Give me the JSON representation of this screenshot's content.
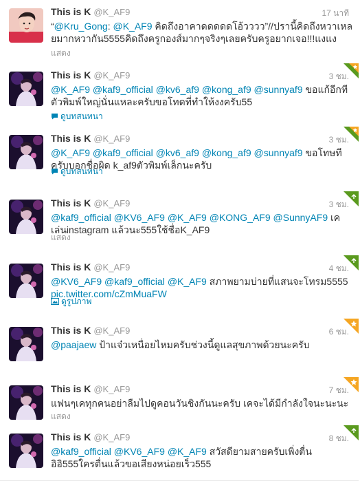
{
  "tweets": [
    {
      "name": "This is K",
      "handle": "@K_AF9",
      "time": "17 นาที",
      "avatar": "selfie-avatar",
      "segments": [
        {
          "t": "“",
          "m": false
        },
        {
          "t": "@Kru_Gong",
          "m": true
        },
        {
          "t": ": ",
          "m": false
        },
        {
          "t": "@K_AF9",
          "m": true
        },
        {
          "t": " คิดถึงอาคาดดดดดโอ้วววว”//ปรานี้คิดถึงหวาเหลยมากหวากัน5555คิดถึงครูกองส์มากๆจริงๆเลยครับครูอยากเจอ!!!แงแง",
          "m": false
        }
      ],
      "action": "แสดง",
      "action_type": "expand",
      "corner": "none"
    },
    {
      "name": "This is K",
      "handle": "@K_AF9",
      "time": "3 ชม.",
      "avatar": "concert-avatar",
      "segments": [
        {
          "t": "@K_AF9",
          "m": true
        },
        {
          "t": " ",
          "m": false
        },
        {
          "t": "@kaf9_official",
          "m": true
        },
        {
          "t": " ",
          "m": false
        },
        {
          "t": "@kv6_af9",
          "m": true
        },
        {
          "t": " ",
          "m": false
        },
        {
          "t": "@kong_af9",
          "m": true
        },
        {
          "t": " ",
          "m": false
        },
        {
          "t": "@sunnyaf9",
          "m": true
        },
        {
          "t": " ขอแก้อีกทีตัวพิมพ์ใหญ่นั่นแหละครับขอโทดที่ทำให้งงครับ55",
          "m": false
        }
      ],
      "action": "ดูบทสนทนา",
      "action_type": "conversation",
      "corner": "retweet-favorite"
    },
    {
      "name": "This is K",
      "handle": "@K_AF9",
      "time": "3 ชม.",
      "avatar": "concert-avatar",
      "segments": [
        {
          "t": "@K_AF9",
          "m": true
        },
        {
          "t": " ",
          "m": false
        },
        {
          "t": "@kaf9_official",
          "m": true
        },
        {
          "t": " ",
          "m": false
        },
        {
          "t": "@kv6_af9",
          "m": true
        },
        {
          "t": " ",
          "m": false
        },
        {
          "t": "@kong_af9",
          "m": true
        },
        {
          "t": " ",
          "m": false
        },
        {
          "t": "@sunnyaf9",
          "m": true
        },
        {
          "t": " ขอโทษทีครับบอกชื่อผิด k_af9ตัวพิมพ์เล็กนะครับ",
          "m": false
        }
      ],
      "action": "ดูบทสนทนา",
      "action_type": "conversation",
      "corner": "retweet-favorite"
    },
    {
      "name": "This is K",
      "handle": "@K_AF9",
      "time": "3 ชม.",
      "avatar": "concert-avatar",
      "segments": [
        {
          "t": "@kaf9_official",
          "m": true
        },
        {
          "t": " ",
          "m": false
        },
        {
          "t": "@KV6_AF9",
          "m": true
        },
        {
          "t": " ",
          "m": false
        },
        {
          "t": "@K_AF9",
          "m": true
        },
        {
          "t": " ",
          "m": false
        },
        {
          "t": "@KONG_AF9",
          "m": true
        },
        {
          "t": " ",
          "m": false
        },
        {
          "t": "@SunnyAF9",
          "m": true
        },
        {
          "t": " เคเล่นinstagram แล้วนะ555ใช้ชื่อK_AF9",
          "m": false
        }
      ],
      "action": "แสดง",
      "action_type": "expand",
      "corner": "retweet"
    },
    {
      "name": "This is K",
      "handle": "@K_AF9",
      "time": "4 ชม.",
      "avatar": "concert-avatar",
      "segments": [
        {
          "t": "@KV6_AF9",
          "m": true
        },
        {
          "t": " ",
          "m": false
        },
        {
          "t": "@kaf9_official",
          "m": true
        },
        {
          "t": " ",
          "m": false
        },
        {
          "t": "@K_AF9",
          "m": true
        },
        {
          "t": " สภาพยามบ่ายที่แสนจะโทรม5555 ",
          "m": false
        },
        {
          "t": "pic.twitter.com/cZmMuaFW",
          "m": true
        }
      ],
      "action": "ดูรูปภาพ",
      "action_type": "photo",
      "corner": "retweet"
    },
    {
      "name": "This is K",
      "handle": "@K_AF9",
      "time": "6 ชม.",
      "avatar": "concert-avatar",
      "segments": [
        {
          "t": "@paajaew",
          "m": true
        },
        {
          "t": " ป้าแจ๋วเหนื่อยไหมครับช่วงนี้ดูแลสุขภาพด้วยนะครับ",
          "m": false
        }
      ],
      "action": "",
      "action_type": "none",
      "corner": "favorite"
    },
    {
      "name": "This is K",
      "handle": "@K_AF9",
      "time": "7 ชม.",
      "avatar": "concert-avatar",
      "segments": [
        {
          "t": "แฟนๆเคทุกคนอย่าลืมไปดูคอนวันชิงกันนะครับ เคจะได้มีกำลังใจนะนะนะ",
          "m": false
        }
      ],
      "action": "แสดง",
      "action_type": "expand",
      "corner": "favorite"
    },
    {
      "name": "This is K",
      "handle": "@K_AF9",
      "time": "8 ชม.",
      "avatar": "concert-avatar",
      "segments": [
        {
          "t": "@kaf9_official",
          "m": true
        },
        {
          "t": " ",
          "m": false
        },
        {
          "t": "@KV6_AF9",
          "m": true
        },
        {
          "t": " ",
          "m": false
        },
        {
          "t": "@K_AF9",
          "m": true
        },
        {
          "t": " สวัสดียามสายครับเพิ่งตื่นอิอิ555ใครตื่นแล้วขอเสียงหน่อยเร็ว555",
          "m": false
        }
      ],
      "action": "",
      "action_type": "none",
      "corner": "retweet"
    }
  ],
  "colors": {
    "mention": "#0084b4",
    "retweet_corner": "#5a9a1e",
    "favorite_corner": "#f5a623"
  }
}
